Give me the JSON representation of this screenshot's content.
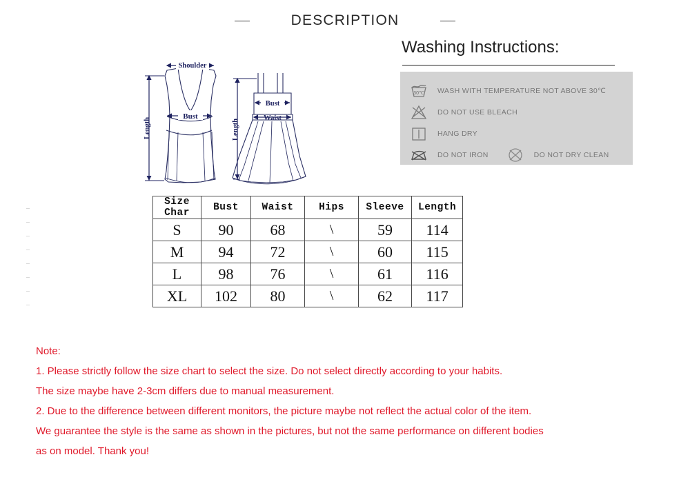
{
  "header": {
    "title": "DESCRIPTION",
    "left_dash": "—",
    "right_dash": "—"
  },
  "diagrams": {
    "top": {
      "name": "v-neck-top",
      "labels": {
        "shoulder": "Shoulder",
        "bust": "Bust",
        "length": "Length"
      }
    },
    "dress": {
      "name": "strap-dress",
      "labels": {
        "bust": "Bust",
        "waist": "Waist",
        "length": "Length"
      }
    },
    "label_color": "#1f2360"
  },
  "washing": {
    "title": "Washing Instructions:",
    "panel_color": "#d3d3d3",
    "text_color": "#777777",
    "items": [
      {
        "icon": "wash-tub-30c-icon",
        "label": "WASH WITH TEMPERATURE NOT ABOVE 30℃",
        "temperature": "30℃"
      },
      {
        "icon": "no-bleach-triangle-icon",
        "label": "DO NOT USE BLEACH"
      },
      {
        "icon": "hang-dry-icon",
        "label": "HANG DRY"
      },
      {
        "icon": "no-iron-icon",
        "label": "DO NOT IRON"
      },
      {
        "icon": "no-dry-clean-icon",
        "label": "DO NOT DRY CLEAN"
      }
    ]
  },
  "size_chart": {
    "headers": [
      "Size Char",
      "Bust",
      "Waist",
      "Hips",
      "Sleeve",
      "Length"
    ],
    "rows": [
      {
        "size": "S",
        "bust": "90",
        "waist": "68",
        "hips": "\\",
        "sleeve": "59",
        "length": "114"
      },
      {
        "size": "M",
        "bust": "94",
        "waist": "72",
        "hips": "\\",
        "sleeve": "60",
        "length": "115"
      },
      {
        "size": "L",
        "bust": "98",
        "waist": "76",
        "hips": "\\",
        "sleeve": "61",
        "length": "116"
      },
      {
        "size": "XL",
        "bust": "102",
        "waist": "80",
        "hips": "\\",
        "sleeve": "62",
        "length": "117"
      }
    ]
  },
  "note": {
    "color": "#e01a2b",
    "lines": [
      "Note:",
      "1. Please strictly follow the size chart to select the size. Do not select directly according to your habits.",
      "The size maybe have 2-3cm differs due to manual measurement.",
      "2. Due to the difference between different monitors, the picture maybe not reflect the actual color of the item.",
      "We guarantee the style is the same as shown in the pictures, but not the same performance on different bodies",
      "as on model. Thank you!"
    ]
  }
}
